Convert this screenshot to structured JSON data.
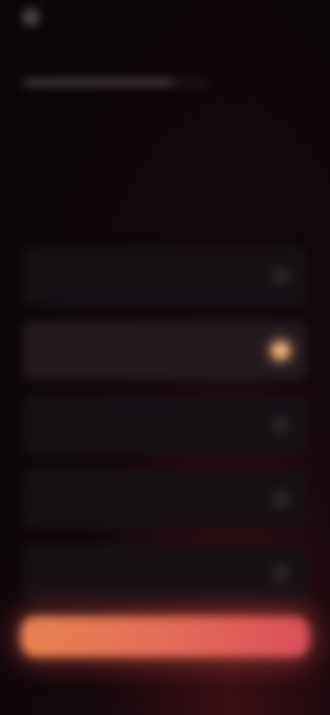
{
  "header": {
    "back_label": "",
    "title": ""
  },
  "progress": {
    "step_text": "",
    "fraction": 0.8
  },
  "question": {
    "title": "",
    "subtitle": "",
    "section_label": ""
  },
  "options": [
    {
      "label": "",
      "selected": false
    },
    {
      "label": "",
      "selected": true
    },
    {
      "label": "",
      "selected": false
    },
    {
      "label": "",
      "selected": false
    },
    {
      "label": "",
      "selected": false
    }
  ],
  "footer": {
    "continue_label": ""
  },
  "colors": {
    "accent": "#f0b77a",
    "button_start": "#e8834f",
    "button_end": "#d9505a"
  },
  "icons": {
    "back": "arrow-left-icon",
    "radio": "radio-icon"
  }
}
